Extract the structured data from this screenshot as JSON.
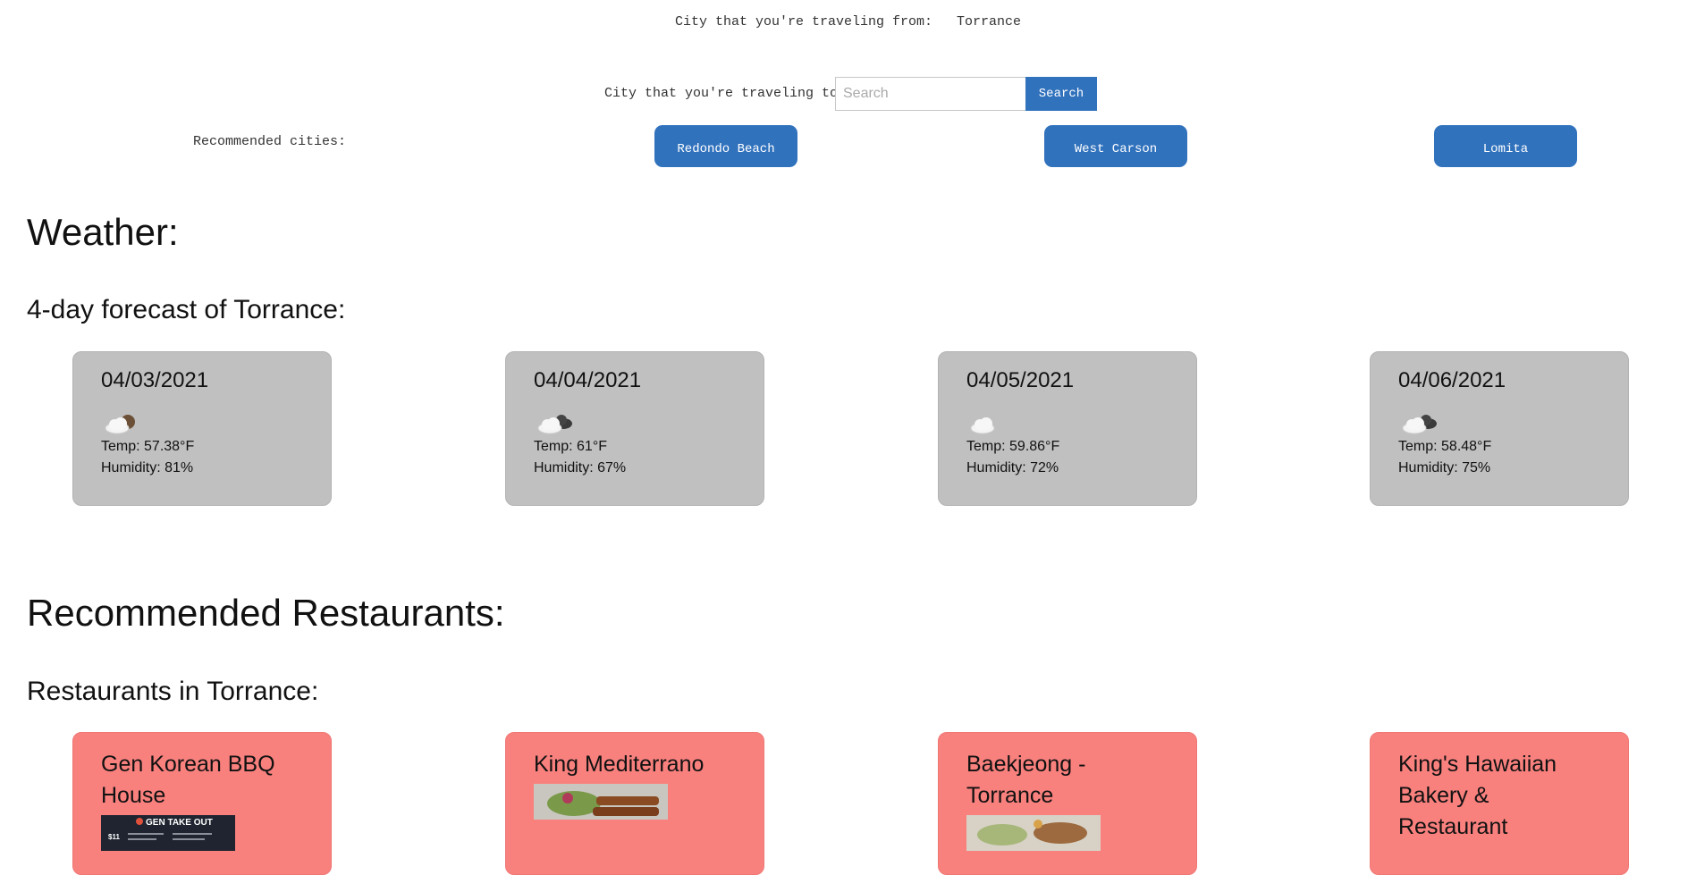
{
  "travel": {
    "from_label": "City that you're traveling from:",
    "from_city": "Torrance",
    "to_label": "City that you're traveling to:",
    "search_placeholder": "Search",
    "search_button": "Search",
    "recommended_label": "Recommended cities:",
    "recommended_cities": [
      "Redondo Beach",
      "West Carson",
      "Lomita"
    ]
  },
  "weather": {
    "heading": "Weather:",
    "forecast_title": "4-day forecast of Torrance:",
    "days": [
      {
        "date": "04/03/2021",
        "icon": "broken-clouds-icon",
        "temp": "Temp: 57.38°F",
        "humidity": "Humidity: 81%"
      },
      {
        "date": "04/04/2021",
        "icon": "scattered-clouds-icon",
        "temp": "Temp: 61°F",
        "humidity": "Humidity: 67%"
      },
      {
        "date": "04/05/2021",
        "icon": "few-clouds-icon",
        "temp": "Temp: 59.86°F",
        "humidity": "Humidity: 72%"
      },
      {
        "date": "04/06/2021",
        "icon": "scattered-clouds-icon",
        "temp": "Temp: 58.48°F",
        "humidity": "Humidity: 75%"
      }
    ]
  },
  "restaurants": {
    "heading": "Recommended Restaurants:",
    "city_title": "Restaurants in Torrance:",
    "items": [
      {
        "name": "Gen Korean BBQ House",
        "photo_text": "GEN TAKE OUT"
      },
      {
        "name": "King Mediterrano"
      },
      {
        "name": "Baekjeong - Torrance"
      },
      {
        "name": "King's Hawaiian Bakery & Restaurant"
      }
    ]
  },
  "colors": {
    "accent_blue": "#3172bd",
    "weather_card": "#c0c0c0",
    "restaurant_card": "#f8817e"
  }
}
